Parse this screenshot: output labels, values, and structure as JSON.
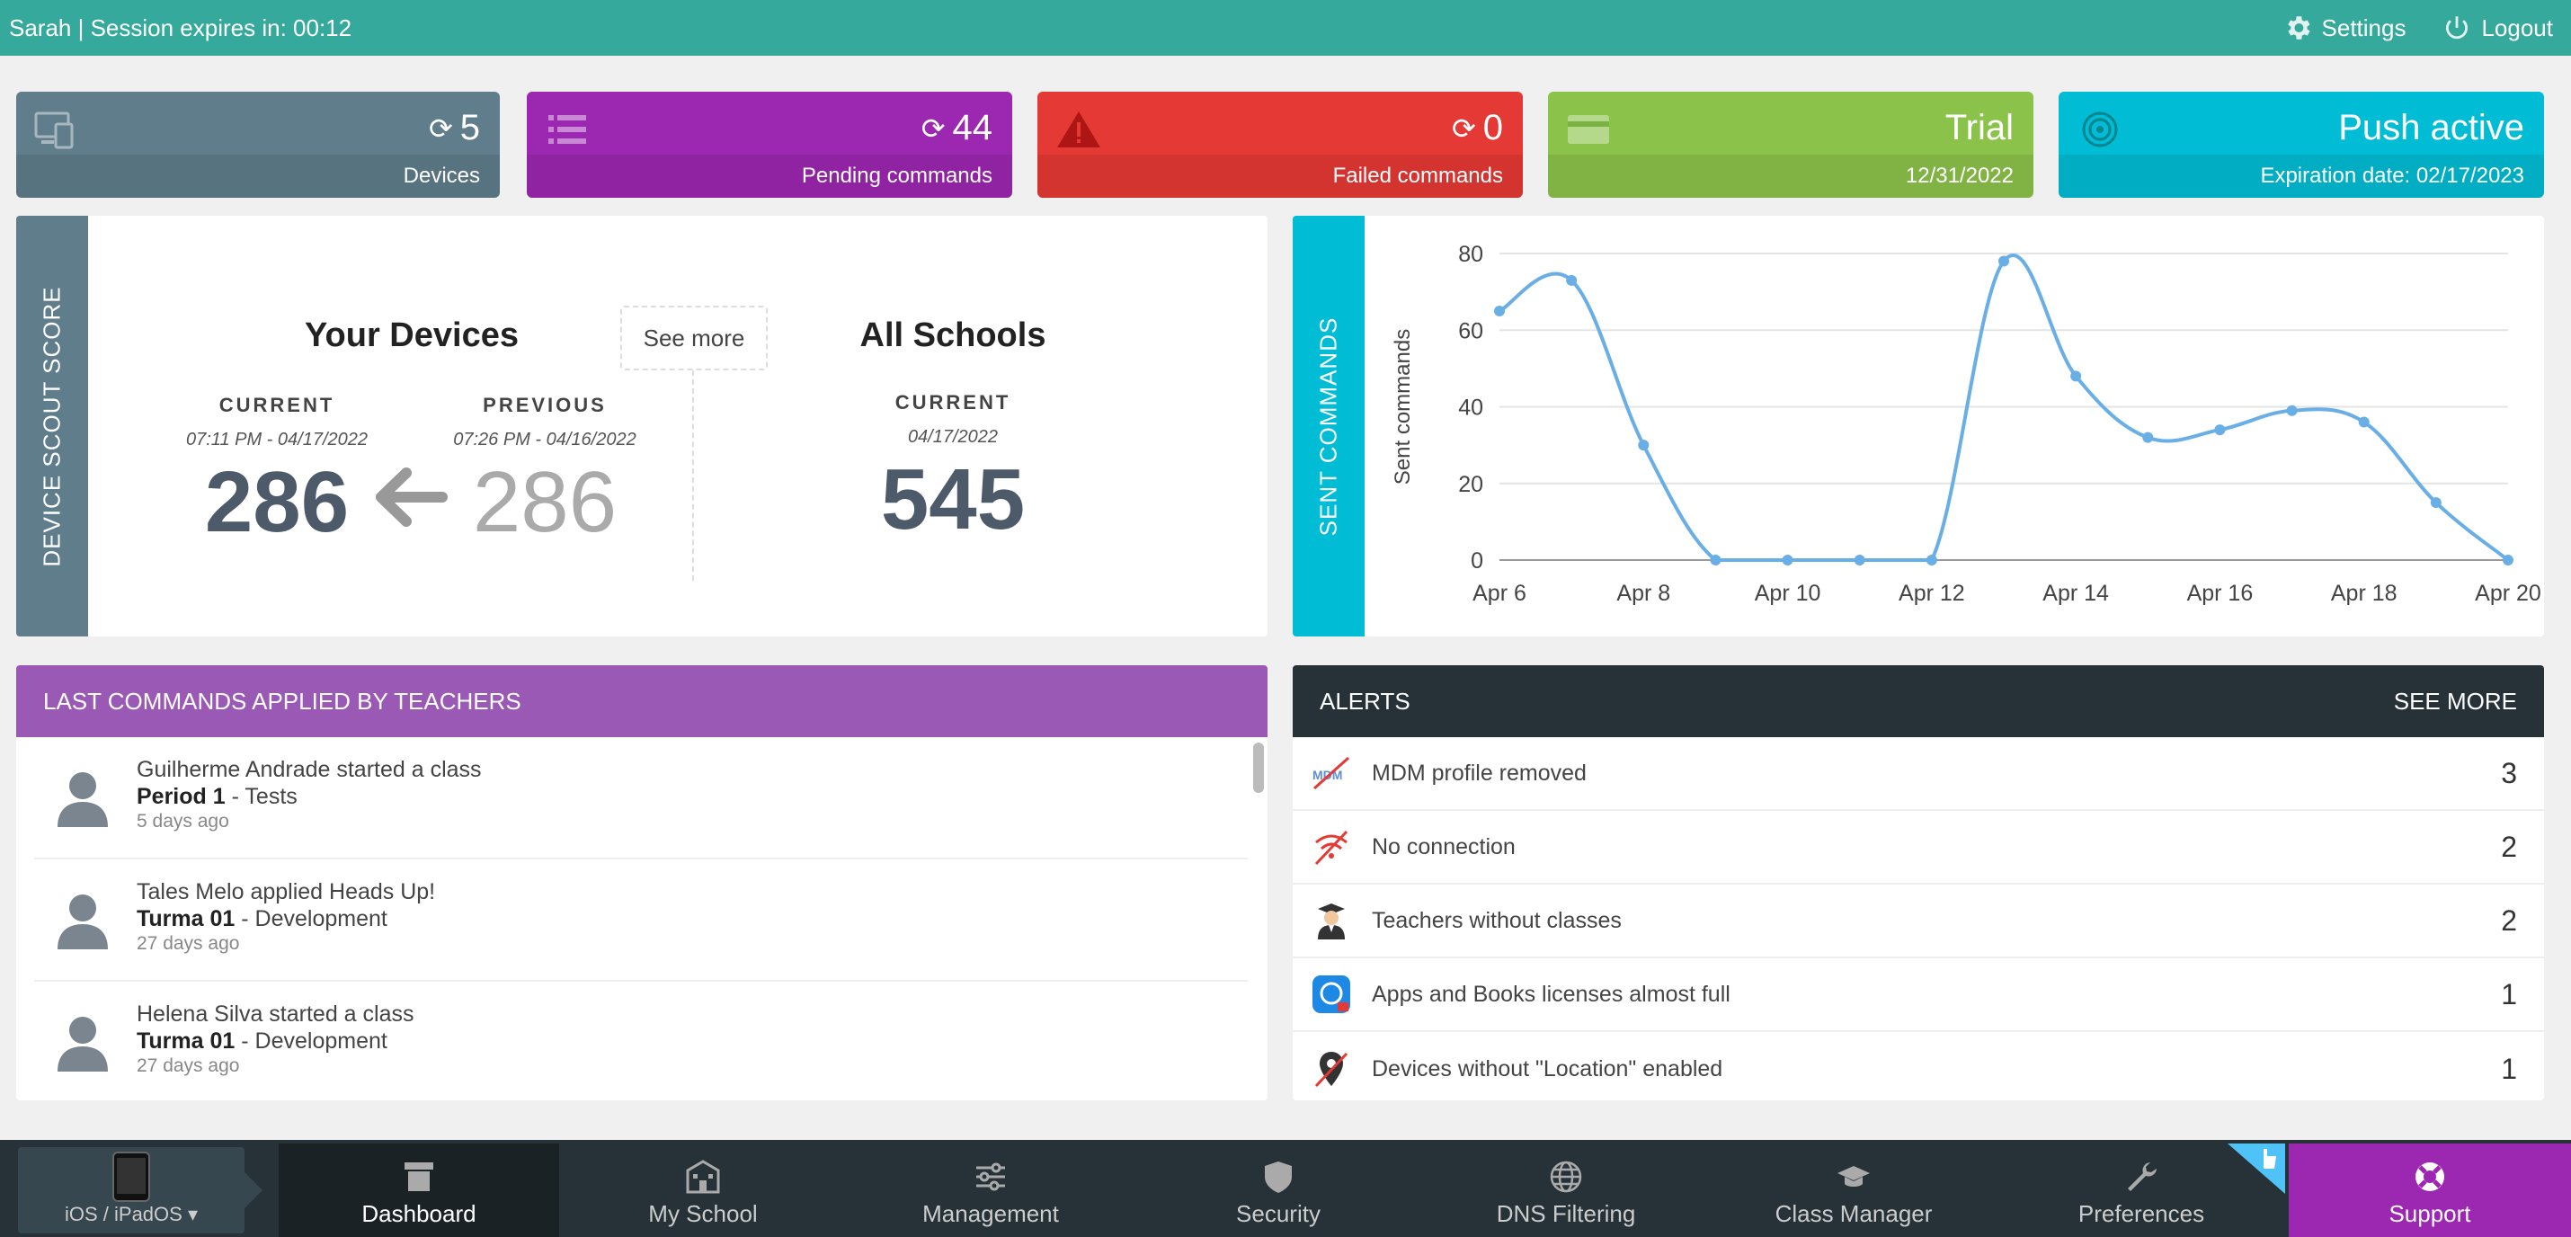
{
  "topbar": {
    "session": "Sarah | Session expires in: 00:12",
    "settings": "Settings",
    "logout": "Logout"
  },
  "cards": [
    {
      "value": "5",
      "label": "Devices",
      "color": "#607d8b",
      "icon": "devices-icon",
      "refresh": true
    },
    {
      "value": "44",
      "label": "Pending commands",
      "color": "#9c27b0",
      "icon": "list-icon",
      "refresh": true
    },
    {
      "value": "0",
      "label": "Failed commands",
      "color": "#e53935",
      "icon": "warning-icon",
      "refresh": true
    },
    {
      "value": "Trial",
      "label": "12/31/2022",
      "color": "#8bc34a",
      "icon": "credit-card-icon",
      "refresh": false
    },
    {
      "value": "Push active",
      "label": "Expiration date: 02/17/2023",
      "color": "#00bcd4",
      "icon": "broadcast-icon",
      "refresh": false
    }
  ],
  "score": {
    "tab_label": "DEVICE SCOUT SCORE",
    "tab_color": "#607d8b",
    "your_devices": "Your Devices",
    "see_more": "See more",
    "current_cap": "CURRENT",
    "previous_cap": "PREVIOUS",
    "current_date": "07:11 PM - 04/17/2022",
    "previous_date": "07:26 PM - 04/16/2022",
    "current_value": "286",
    "previous_value": "286",
    "all_schools": "All Schools",
    "all_current_cap": "CURRENT",
    "all_date": "04/17/2022",
    "all_value": "545"
  },
  "sent": {
    "tab_label": "SENT COMMANDS",
    "tab_color": "#00bcd4"
  },
  "chart_data": {
    "type": "line",
    "x": [
      "Apr 6",
      "Apr 7",
      "Apr 8",
      "Apr 9",
      "Apr 10",
      "Apr 11",
      "Apr 12",
      "Apr 13",
      "Apr 14",
      "Apr 15",
      "Apr 16",
      "Apr 17",
      "Apr 18",
      "Apr 19",
      "Apr 20"
    ],
    "tick_labels": [
      "Apr 6",
      "Apr 8",
      "Apr 10",
      "Apr 12",
      "Apr 14",
      "Apr 16",
      "Apr 18",
      "Apr 20"
    ],
    "series": [
      {
        "values": [
          65,
          73,
          30,
          0,
          0,
          0,
          0,
          78,
          48,
          32,
          34,
          39,
          36,
          15,
          0
        ],
        "color": "#6aaee6"
      }
    ],
    "ylabel": "Sent commands",
    "xlabel": "",
    "ylim": [
      0,
      80
    ],
    "yticks": [
      0,
      20,
      40,
      60,
      80
    ],
    "grid": true
  },
  "commands": {
    "header": "LAST COMMANDS APPLIED BY TEACHERS",
    "header_color": "#9b59b6",
    "items": [
      {
        "action": "Guilherme Andrade started a class",
        "class": "Period 1",
        "detail": " - Tests",
        "ago": "5 days ago"
      },
      {
        "action": "Tales Melo applied Heads Up!",
        "class": "Turma 01",
        "detail": " - Development",
        "ago": "27 days ago"
      },
      {
        "action": "Helena Silva started a class",
        "class": "Turma 01",
        "detail": " - Development",
        "ago": "27 days ago"
      }
    ]
  },
  "alerts": {
    "header": "ALERTS",
    "see_more": "SEE MORE",
    "items": [
      {
        "text": "MDM profile removed",
        "count": "3",
        "icon": "mdm-removed-icon"
      },
      {
        "text": "No connection",
        "count": "2",
        "icon": "no-wifi-icon"
      },
      {
        "text": "Teachers without classes",
        "count": "2",
        "icon": "teacher-icon"
      },
      {
        "text": "Apps and Books licenses almost full",
        "count": "1",
        "icon": "app-store-icon"
      },
      {
        "text": "Devices without \"Location\" enabled",
        "count": "1",
        "icon": "location-off-icon"
      }
    ]
  },
  "nav": {
    "platform": "iOS / iPadOS ▾",
    "items": [
      {
        "label": "Dashboard",
        "icon": "dashboard-icon",
        "active": true
      },
      {
        "label": "My School",
        "icon": "school-icon"
      },
      {
        "label": "Management",
        "icon": "sliders-icon"
      },
      {
        "label": "Security",
        "icon": "shield-icon"
      },
      {
        "label": "DNS Filtering",
        "icon": "globe-icon"
      },
      {
        "label": "Class Manager",
        "icon": "graduation-cap-icon"
      },
      {
        "label": "Preferences",
        "icon": "wrench-icon"
      },
      {
        "label": "Support",
        "icon": "lifebuoy-icon",
        "support": true
      }
    ]
  }
}
